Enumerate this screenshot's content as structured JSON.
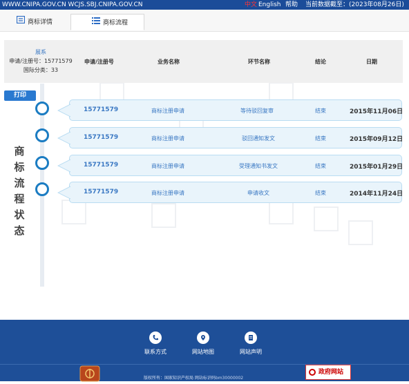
{
  "topbar": {
    "site_links": "WWW.CNIPA.GOV.CN WCJS.SBJ.CNIPA.GOV.CN",
    "lang_cn": "中文",
    "lang_en": "English",
    "help": "帮助",
    "data_as_of": "当前数据截至：(2023年08月26日)"
  },
  "tabs": [
    {
      "label": "商标详情",
      "icon": "list-icon"
    },
    {
      "label": "商标流程",
      "icon": "flow-icon"
    }
  ],
  "appinfo": {
    "link": "展系",
    "reg_no": "申请/注册号：15771579",
    "intl_class": "国际分类：33"
  },
  "columns": [
    "申请/注册号",
    "业务名称",
    "环节名称",
    "结论",
    "日期"
  ],
  "print_label": "打印",
  "vertical_title": [
    "商",
    "标",
    "流",
    "程",
    "状",
    "态"
  ],
  "rows": [
    {
      "number": "15771579",
      "business": "商标注册申请",
      "step": "等待驳回复审",
      "result": "结束",
      "date": "2015年11月06日"
    },
    {
      "number": "15771579",
      "business": "商标注册申请",
      "step": "驳回通知发文",
      "result": "结束",
      "date": "2015年09月12日"
    },
    {
      "number": "15771579",
      "business": "商标注册申请",
      "step": "受理通知书发文",
      "result": "结束",
      "date": "2015年01月29日"
    },
    {
      "number": "15771579",
      "business": "商标注册申请",
      "step": "申请收文",
      "result": "结束",
      "date": "2014年11月24日"
    }
  ],
  "footer": {
    "links": [
      {
        "label": "联系方式",
        "icon": "phone-icon"
      },
      {
        "label": "网站地图",
        "icon": "map-pin-icon"
      },
      {
        "label": "网站声明",
        "icon": "document-icon"
      }
    ],
    "copyright": "版权所有：国家知识产权局 网站标识码bm30000002",
    "gov_badge": "政府网站"
  },
  "colors": {
    "topbar": "#1b4c99",
    "accent": "#2979d0",
    "footer": "#1e4f98",
    "row_bg": "#e9f4fb"
  }
}
